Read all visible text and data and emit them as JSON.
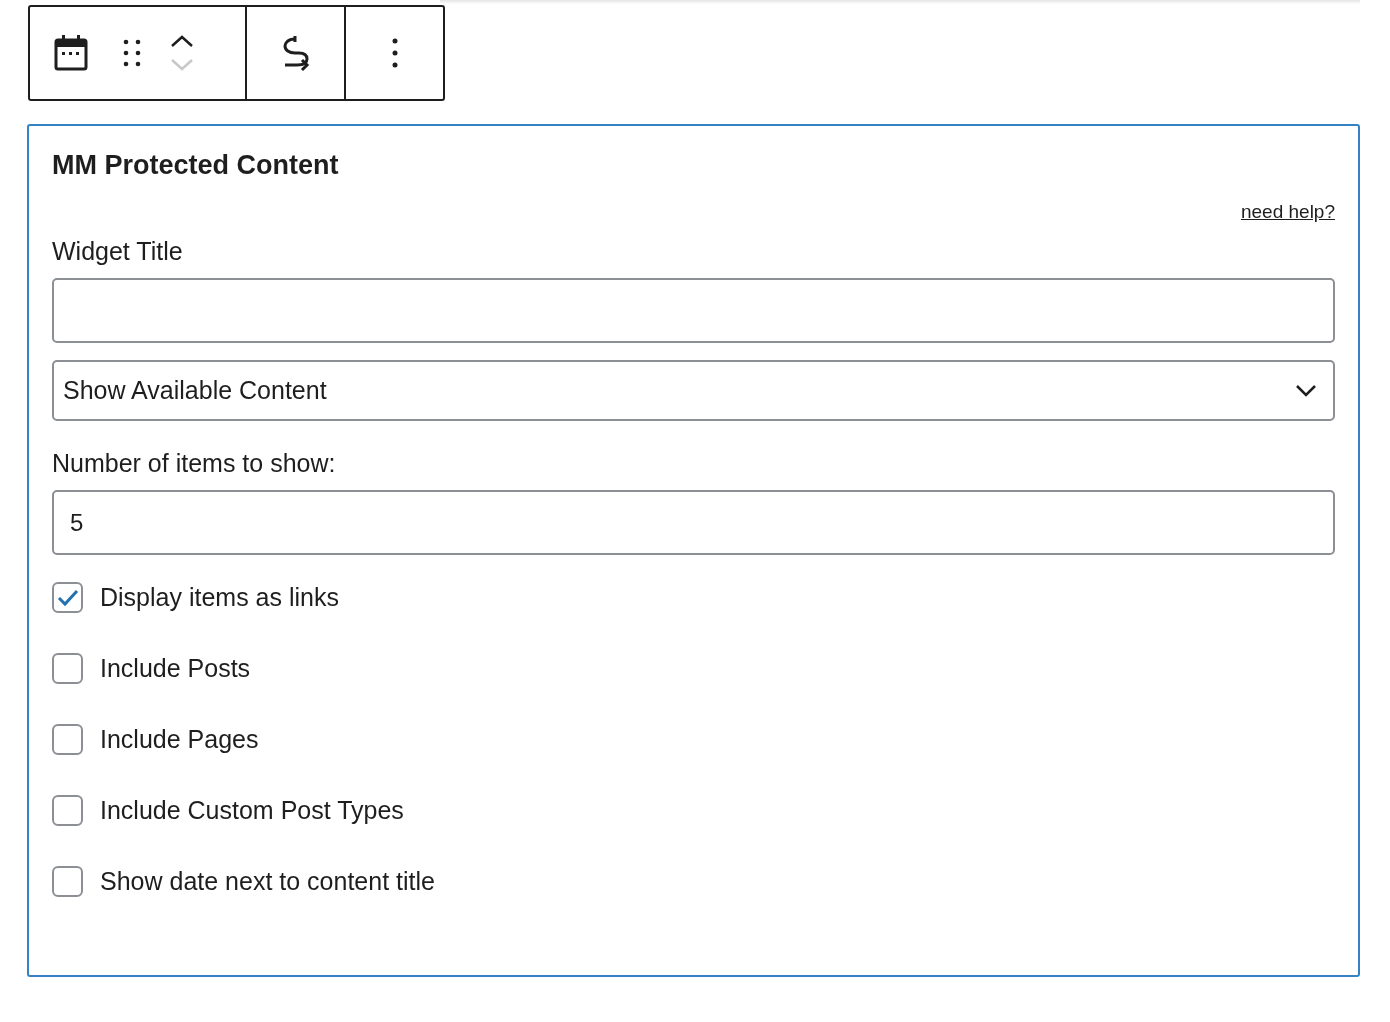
{
  "toolbar": {
    "move_up": {
      "disabled": false
    },
    "move_down": {
      "disabled": true
    }
  },
  "widget": {
    "title": "MM Protected Content",
    "help_link": "need help?",
    "title_field": {
      "label": "Widget Title"
    },
    "content_select": {
      "value": "Show Available Content"
    },
    "count_field": {
      "label": "Number of items to show:",
      "value": "5"
    },
    "options": [
      {
        "label": "Display items as links",
        "checked": true
      },
      {
        "label": "Include Posts",
        "checked": false
      },
      {
        "label": "Include Pages",
        "checked": false
      },
      {
        "label": "Include Custom Post Types",
        "checked": false
      },
      {
        "label": "Show date next to content title",
        "checked": false
      }
    ]
  }
}
